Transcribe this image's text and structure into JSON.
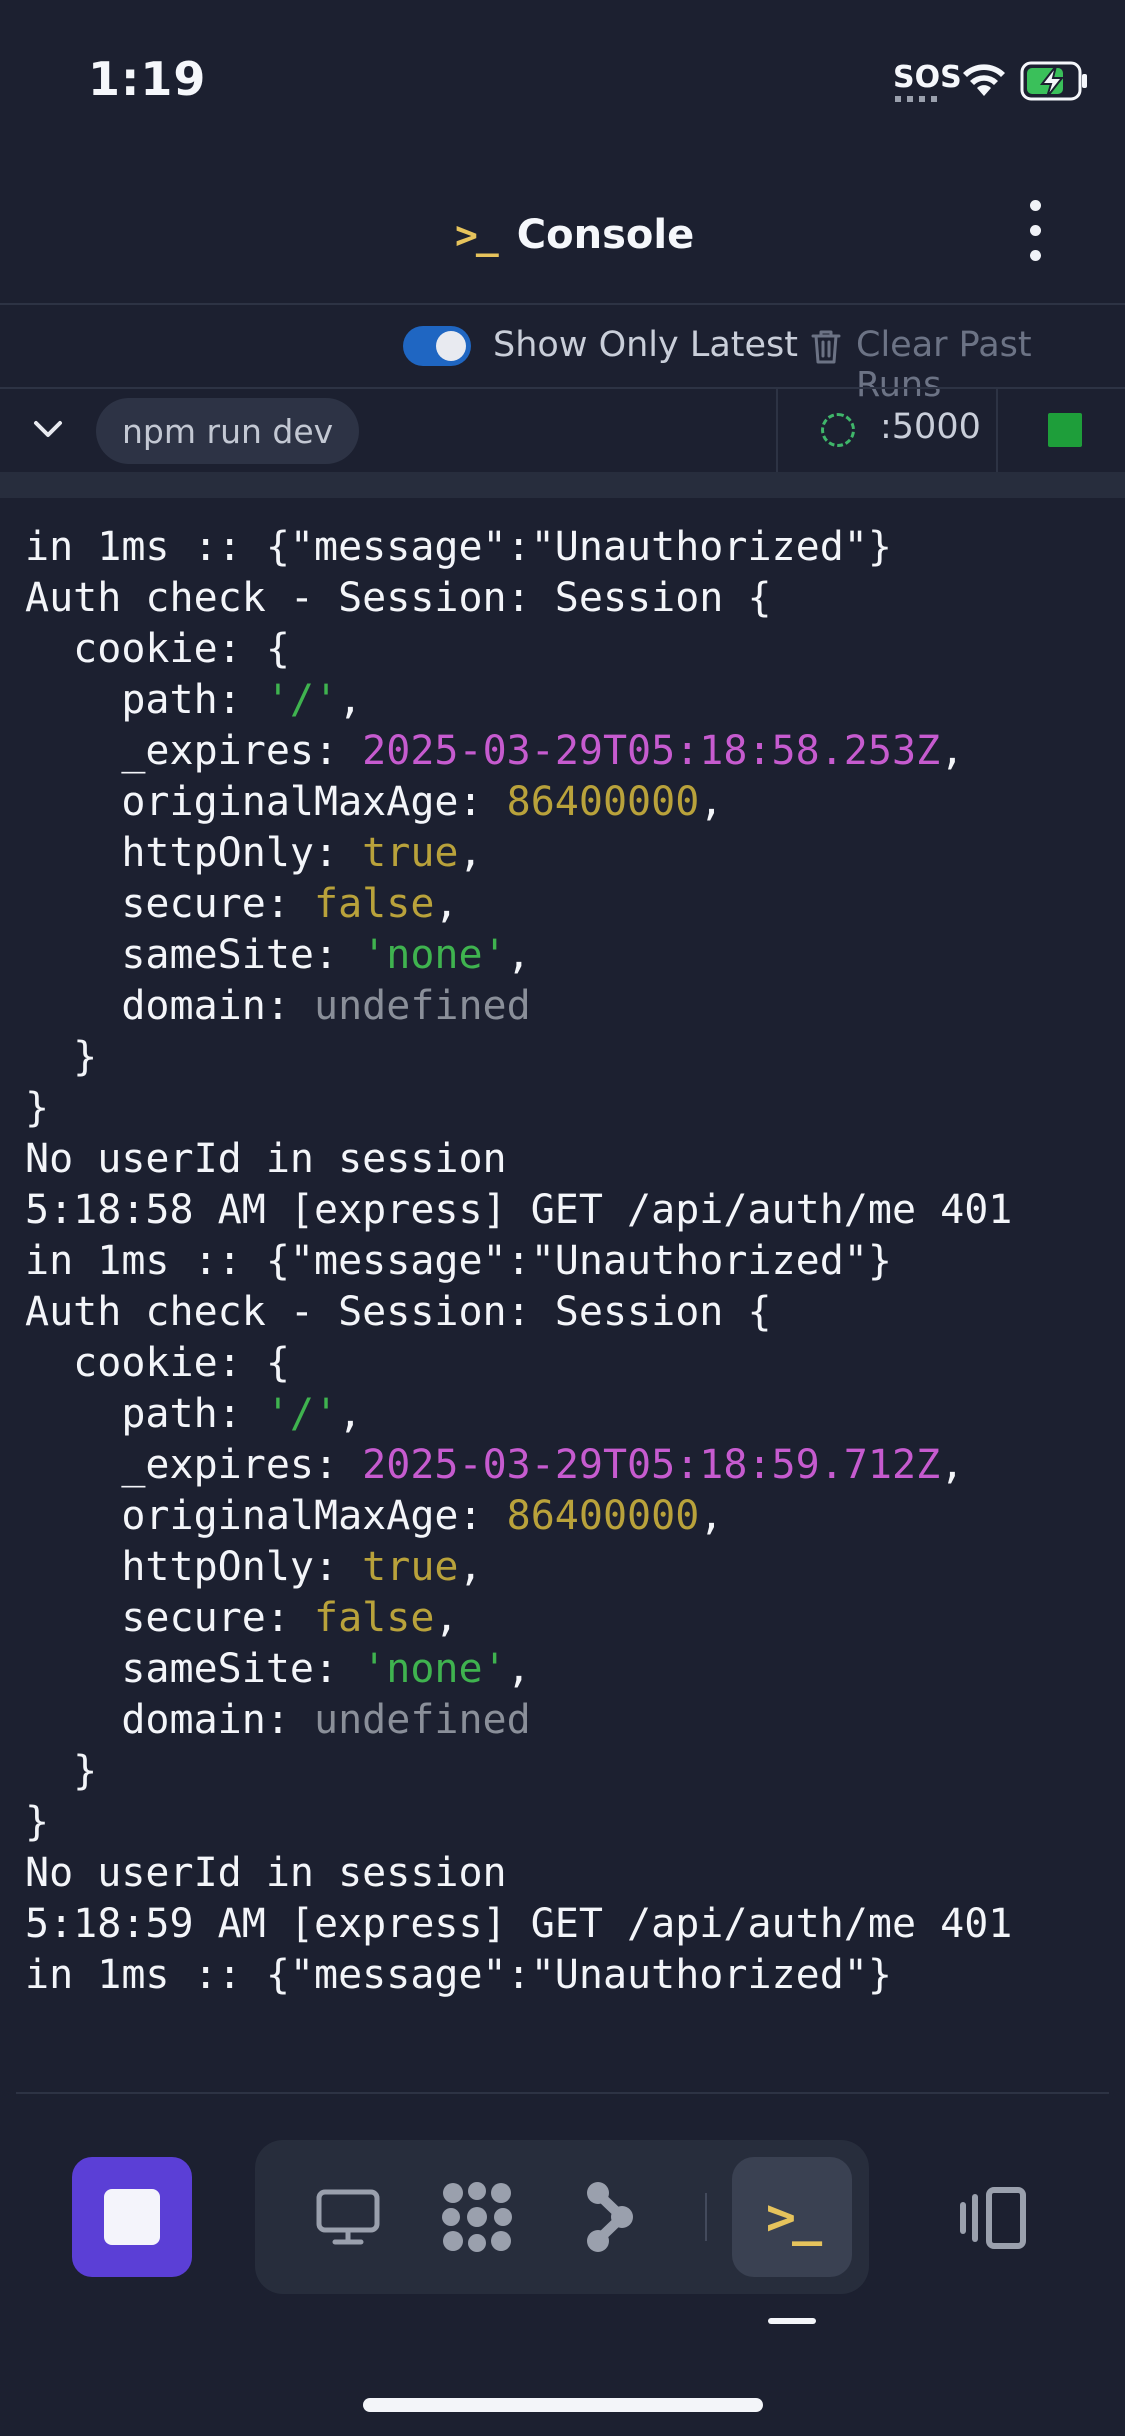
{
  "status_bar": {
    "time": "1:19",
    "sos": "SOS"
  },
  "header": {
    "icon_glyph": ">_",
    "title": "Console"
  },
  "toolbar": {
    "toggle_label": "Show Only Latest",
    "toggle_on": true,
    "clear_label": "Clear Past Runs"
  },
  "runbar": {
    "command": "npm run dev",
    "port": ":5000"
  },
  "console": {
    "lines": [
      [
        {
          "t": "in 1ms :: {\"message\":\"Unauthorized\"}",
          "c": ""
        }
      ],
      [
        {
          "t": "Auth check - Session: Session {",
          "c": ""
        }
      ],
      [
        {
          "t": "  cookie: {",
          "c": ""
        }
      ],
      [
        {
          "t": "    path: ",
          "c": ""
        },
        {
          "t": "'/'",
          "c": "green"
        },
        {
          "t": ",",
          "c": ""
        }
      ],
      [
        {
          "t": "    _expires: ",
          "c": ""
        },
        {
          "t": "2025-03-29T05:18:58.253Z",
          "c": "magenta"
        },
        {
          "t": ",",
          "c": ""
        }
      ],
      [
        {
          "t": "    originalMaxAge: ",
          "c": ""
        },
        {
          "t": "86400000",
          "c": "yellow"
        },
        {
          "t": ",",
          "c": ""
        }
      ],
      [
        {
          "t": "    httpOnly: ",
          "c": ""
        },
        {
          "t": "true",
          "c": "yellow"
        },
        {
          "t": ",",
          "c": ""
        }
      ],
      [
        {
          "t": "    secure: ",
          "c": ""
        },
        {
          "t": "false",
          "c": "yellow"
        },
        {
          "t": ",",
          "c": ""
        }
      ],
      [
        {
          "t": "    sameSite: ",
          "c": ""
        },
        {
          "t": "'none'",
          "c": "green"
        },
        {
          "t": ",",
          "c": ""
        }
      ],
      [
        {
          "t": "    domain: ",
          "c": ""
        },
        {
          "t": "undefined",
          "c": "gray"
        }
      ],
      [
        {
          "t": "  }",
          "c": ""
        }
      ],
      [
        {
          "t": "}",
          "c": ""
        }
      ],
      [
        {
          "t": "No userId in session",
          "c": ""
        }
      ],
      [
        {
          "t": "5:18:58 AM [express] GET /api/auth/me 401",
          "c": ""
        }
      ],
      [
        {
          "t": "in 1ms :: {\"message\":\"Unauthorized\"}",
          "c": ""
        }
      ],
      [
        {
          "t": "Auth check - Session: Session {",
          "c": ""
        }
      ],
      [
        {
          "t": "  cookie: {",
          "c": ""
        }
      ],
      [
        {
          "t": "    path: ",
          "c": ""
        },
        {
          "t": "'/'",
          "c": "green"
        },
        {
          "t": ",",
          "c": ""
        }
      ],
      [
        {
          "t": "    _expires: ",
          "c": ""
        },
        {
          "t": "2025-03-29T05:18:59.712Z",
          "c": "magenta"
        },
        {
          "t": ",",
          "c": ""
        }
      ],
      [
        {
          "t": "    originalMaxAge: ",
          "c": ""
        },
        {
          "t": "86400000",
          "c": "yellow"
        },
        {
          "t": ",",
          "c": ""
        }
      ],
      [
        {
          "t": "    httpOnly: ",
          "c": ""
        },
        {
          "t": "true",
          "c": "yellow"
        },
        {
          "t": ",",
          "c": ""
        }
      ],
      [
        {
          "t": "    secure: ",
          "c": ""
        },
        {
          "t": "false",
          "c": "yellow"
        },
        {
          "t": ",",
          "c": ""
        }
      ],
      [
        {
          "t": "    sameSite: ",
          "c": ""
        },
        {
          "t": "'none'",
          "c": "green"
        },
        {
          "t": ",",
          "c": ""
        }
      ],
      [
        {
          "t": "    domain: ",
          "c": ""
        },
        {
          "t": "undefined",
          "c": "gray"
        }
      ],
      [
        {
          "t": "  }",
          "c": ""
        }
      ],
      [
        {
          "t": "}",
          "c": ""
        }
      ],
      [
        {
          "t": "No userId in session",
          "c": ""
        }
      ],
      [
        {
          "t": "5:18:59 AM [express] GET /api/auth/me 401",
          "c": ""
        }
      ],
      [
        {
          "t": "in 1ms :: {\"message\":\"Unauthorized\"}",
          "c": ""
        }
      ]
    ]
  },
  "bottom_bar": {
    "tabs": [
      {
        "name": "webview-tab",
        "icon": "monitor-icon"
      },
      {
        "name": "workflows-tab",
        "icon": "grid-dots-icon"
      },
      {
        "name": "git-tab",
        "icon": "git-branch-icon"
      },
      {
        "name": "console-tab",
        "icon": "console-icon",
        "glyph": ">_",
        "active": true
      }
    ],
    "side_icon": "split-view-icon"
  },
  "colors": {
    "background": "#1c2030",
    "accent_purple": "#5b3fd6",
    "toggle_blue": "#1f66c2",
    "running_green": "#1e9e3a",
    "console_yellow": "#e6c35c"
  }
}
